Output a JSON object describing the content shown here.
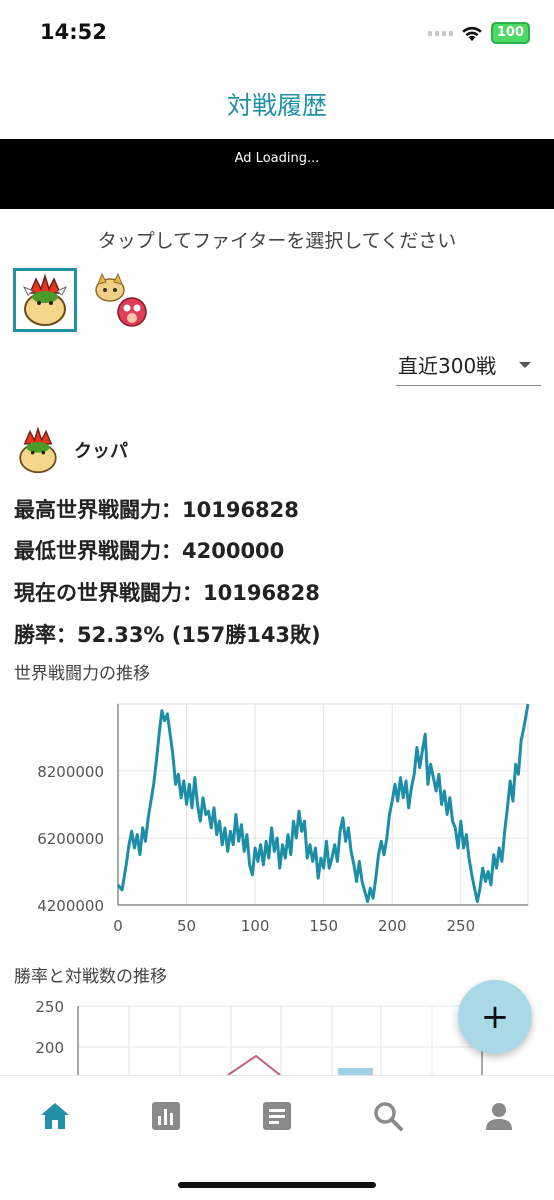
{
  "status": {
    "time": "14:52",
    "battery": "100"
  },
  "header": {
    "title": "対戦履歴"
  },
  "ad": {
    "text": "Ad Loading..."
  },
  "selector": {
    "instruction": "タップしてファイターを選択してください"
  },
  "filter": {
    "selected": "直近300戦"
  },
  "character": {
    "name": "クッパ"
  },
  "stats": {
    "highest": "最高世界戦闘力：10196828",
    "lowest": "最低世界戦闘力：4200000",
    "current": "現在の世界戦闘力：10196828",
    "winrate": "勝率：52.33% (157勝143敗)"
  },
  "sections": {
    "power_trend": "世界戦闘力の推移",
    "winrate_trend": "勝率と対戦数の推移"
  },
  "fab": {
    "label": "+"
  },
  "nav": {
    "items": [
      {
        "icon": "home-icon",
        "active": true
      },
      {
        "icon": "bar-chart-icon",
        "active": false
      },
      {
        "icon": "document-icon",
        "active": false
      },
      {
        "icon": "search-icon",
        "active": false
      },
      {
        "icon": "person-icon",
        "active": false
      }
    ]
  },
  "colors": {
    "accent": "#2191a6",
    "line": "#1c8ea8",
    "fab": "#a9d9e7",
    "pink": "#c0607a",
    "bar": "#9fd3e3"
  },
  "chart_data": [
    {
      "type": "line",
      "title": "世界戦闘力の推移",
      "xlim": [
        0,
        299
      ],
      "ylim": [
        4200000,
        10196828
      ],
      "xticks": [
        0,
        50,
        100,
        150,
        200,
        250
      ],
      "yticks": [
        4200000,
        6200000,
        8200000
      ],
      "grid": true,
      "series": [
        {
          "x": [
            0,
            3,
            6,
            8,
            10,
            12,
            14,
            16,
            18,
            20,
            22,
            24,
            26,
            28,
            30,
            32,
            34,
            36,
            38,
            40,
            42,
            44,
            46,
            48,
            50,
            52,
            54,
            56,
            58,
            60,
            62,
            64,
            66,
            68,
            70,
            72,
            74,
            76,
            78,
            80,
            82,
            84,
            86,
            88,
            90,
            92,
            94,
            96,
            98,
            100,
            102,
            104,
            106,
            108,
            110,
            112,
            114,
            116,
            118,
            120,
            122,
            124,
            126,
            128,
            130,
            132,
            134,
            136,
            138,
            140,
            142,
            144,
            146,
            148,
            150,
            152,
            154,
            156,
            158,
            160,
            162,
            164,
            166,
            168,
            170,
            172,
            174,
            176,
            178,
            180,
            182,
            184,
            186,
            188,
            190,
            192,
            194,
            196,
            198,
            200,
            202,
            204,
            206,
            208,
            210,
            212,
            214,
            216,
            218,
            220,
            222,
            224,
            226,
            228,
            230,
            232,
            234,
            236,
            238,
            240,
            242,
            244,
            246,
            248,
            250,
            252,
            254,
            256,
            258,
            260,
            262,
            264,
            266,
            268,
            270,
            272,
            274,
            276,
            278,
            280,
            282,
            284,
            286,
            288,
            290,
            292,
            294,
            296,
            299
          ],
          "y": [
            4800000,
            4650000,
            5400000,
            6000000,
            6400000,
            5900000,
            6300000,
            5700000,
            6500000,
            6100000,
            6800000,
            7300000,
            7800000,
            8500000,
            9300000,
            10000000,
            9700000,
            9900000,
            9300000,
            8700000,
            7800000,
            8100000,
            7400000,
            7900000,
            7200000,
            7800000,
            7100000,
            8000000,
            7200000,
            6700000,
            7400000,
            6900000,
            7000000,
            6500000,
            7100000,
            6300000,
            6700000,
            6000000,
            6500000,
            5800000,
            6400000,
            6000000,
            6900000,
            6100000,
            6600000,
            5800000,
            6300000,
            5400000,
            5100000,
            5900000,
            5500000,
            6000000,
            5400000,
            6100000,
            5600000,
            6500000,
            5800000,
            6200000,
            5300000,
            6000000,
            5600000,
            6300000,
            5700000,
            6700000,
            6200000,
            7000000,
            6400000,
            6700000,
            5600000,
            6000000,
            5500000,
            5900000,
            5000000,
            5600000,
            5300000,
            6100000,
            5300000,
            5600000,
            6000000,
            5500000,
            6400000,
            6800000,
            6100000,
            6500000,
            5800000,
            5400000,
            4900000,
            5500000,
            4900000,
            4600000,
            4300000,
            4700000,
            4400000,
            5000000,
            5700000,
            6100000,
            5700000,
            6200000,
            6900000,
            7300000,
            7800000,
            7300000,
            8000000,
            7400000,
            7900000,
            7100000,
            7700000,
            8100000,
            8900000,
            8300000,
            8800000,
            9300000,
            7800000,
            8400000,
            8000000,
            7600000,
            8100000,
            7200000,
            7600000,
            6900000,
            7400000,
            6700000,
            6500000,
            5900000,
            6700000,
            5900000,
            6300000,
            5600000,
            5100000,
            4700000,
            4300000,
            4700000,
            5300000,
            4900000,
            5200000,
            4800000,
            5700000,
            5300000,
            5900000,
            5500000,
            6400000,
            7100000,
            7900000,
            7300000,
            8400000,
            8100000,
            9100000,
            9500000,
            10196828
          ]
        }
      ]
    },
    {
      "type": "line",
      "title": "勝率と対戦数の推移",
      "yticks": [
        200,
        250
      ],
      "grid": true,
      "series": [
        {
          "type": "line",
          "values": []
        },
        {
          "type": "bar",
          "values": []
        }
      ]
    }
  ]
}
